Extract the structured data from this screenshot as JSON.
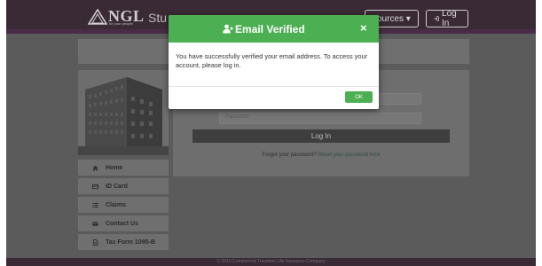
{
  "header": {
    "logo_text": "NGL",
    "logo_tagline": "for your people",
    "brand_title": "Stu",
    "resources_label": "sources ▾",
    "login_label": "Log In"
  },
  "form": {
    "password_placeholder": "Password",
    "login_button": "Log In",
    "forgot_text": "Forgot your password?",
    "reset_link": "Reset your password here"
  },
  "sidebar": {
    "items": [
      {
        "label": "Home",
        "icon": "home-icon"
      },
      {
        "label": "ID Card",
        "icon": "id-card-icon"
      },
      {
        "label": "Claims",
        "icon": "list-icon"
      },
      {
        "label": "Contact Us",
        "icon": "envelope-icon"
      },
      {
        "label": "Tax Form 1095-B",
        "icon": "document-icon"
      }
    ]
  },
  "footer": {
    "copyright": "© 2019 Commercial Travelers Life Insurance Company"
  },
  "modal": {
    "title": "Email Verified",
    "close": "×",
    "body": "You have successfully verified your email address. To access your account, please log in.",
    "ok_label": "OK"
  },
  "colors": {
    "modal_accent": "#4cb052",
    "header_bg": "#3a2a36",
    "purple_accent": "#4a2b47"
  }
}
